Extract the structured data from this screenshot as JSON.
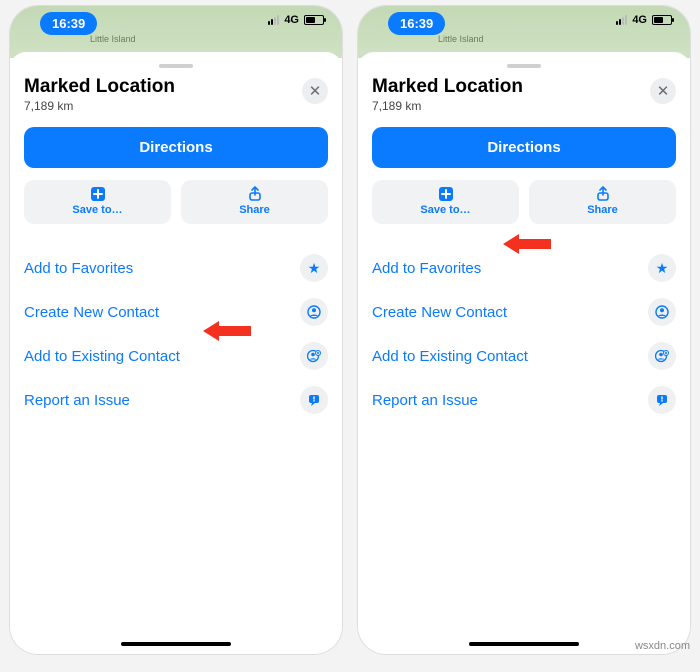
{
  "status": {
    "time": "16:39",
    "network": "4G"
  },
  "map": {
    "label": "Little Island"
  },
  "sheet": {
    "title": "Marked Location",
    "subtitle": "7,189 km",
    "directions": "Directions",
    "save": "Save to…",
    "share": "Share",
    "rows": {
      "favorites": "Add to Favorites",
      "newContact": "Create New Contact",
      "existingContact": "Add to Existing Contact",
      "report": "Report an Issue"
    }
  },
  "watermark": "wsxdn.com"
}
